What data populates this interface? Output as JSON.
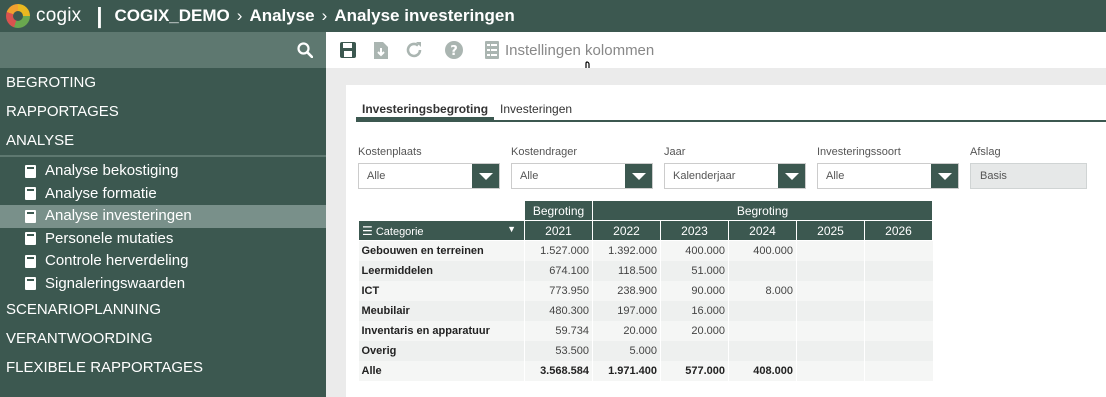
{
  "header": {
    "logo_text": "cogix",
    "separator": "|",
    "breadcrumb": [
      "COGIX_DEMO",
      "Analyse",
      "Analyse investeringen"
    ],
    "chevron": "›"
  },
  "sidebar": {
    "search_icon": "search-icon",
    "sections_before": [
      {
        "label": "BEGROTING"
      },
      {
        "label": "RAPPORTAGES"
      },
      {
        "label": "ANALYSE"
      }
    ],
    "analyse_items": [
      {
        "label": "Analyse bekostiging",
        "active": false
      },
      {
        "label": "Analyse formatie",
        "active": false
      },
      {
        "label": "Analyse investeringen",
        "active": true
      },
      {
        "label": "Personele mutaties",
        "active": false
      },
      {
        "label": "Controle herverdeling",
        "active": false
      },
      {
        "label": "Signaleringswaarden",
        "active": false
      }
    ],
    "sections_after": [
      {
        "label": "SCENARIOPLANNING"
      },
      {
        "label": "VERANTWOORDING"
      },
      {
        "label": "FLEXIBELE RAPPORTAGES"
      }
    ]
  },
  "toolbar": {
    "icons": [
      "save-icon",
      "download-icon",
      "refresh-icon",
      "help-icon",
      "columns-settings-icon"
    ],
    "settings_label": "Instellingen kolommen"
  },
  "tabs": [
    {
      "label": "Investeringsbegroting",
      "active": true
    },
    {
      "label": "Investeringen",
      "active": false
    }
  ],
  "filters": {
    "kostenplaats": {
      "label": "Kostenplaats",
      "value": "Alle"
    },
    "kostendrager": {
      "label": "Kostendrager",
      "value": "Alle"
    },
    "jaar": {
      "label": "Jaar",
      "value": "Kalenderjaar"
    },
    "investeringssoort": {
      "label": "Investeringssoort",
      "value": "Alle"
    },
    "afslag": {
      "label": "Afslag",
      "value": "Basis"
    }
  },
  "table": {
    "group_headers": [
      "Begroting",
      "Begroting"
    ],
    "category_header": "Categorie",
    "years": [
      "2021",
      "2022",
      "2023",
      "2024",
      "2025",
      "2026"
    ],
    "rows": [
      {
        "label": "Gebouwen en terreinen",
        "values": [
          "1.527.000",
          "1.392.000",
          "400.000",
          "400.000",
          "",
          ""
        ]
      },
      {
        "label": "Leermiddelen",
        "values": [
          "674.100",
          "118.500",
          "51.000",
          "",
          "",
          ""
        ]
      },
      {
        "label": "ICT",
        "values": [
          "773.950",
          "238.900",
          "90.000",
          "8.000",
          "",
          ""
        ]
      },
      {
        "label": "Meubilair",
        "values": [
          "480.300",
          "197.000",
          "16.000",
          "",
          "",
          ""
        ]
      },
      {
        "label": "Inventaris en apparatuur",
        "values": [
          "59.734",
          "20.000",
          "20.000",
          "",
          "",
          ""
        ]
      },
      {
        "label": "Overig",
        "values": [
          "53.500",
          "5.000",
          "",
          "",
          "",
          ""
        ]
      },
      {
        "label": "Alle",
        "values": [
          "3.568.584",
          "1.971.400",
          "577.000",
          "408.000",
          "",
          ""
        ]
      }
    ]
  },
  "colors": {
    "brand_dark": "#3c5850",
    "sidebar_search": "#5e7870",
    "active_item": "#79908a"
  }
}
